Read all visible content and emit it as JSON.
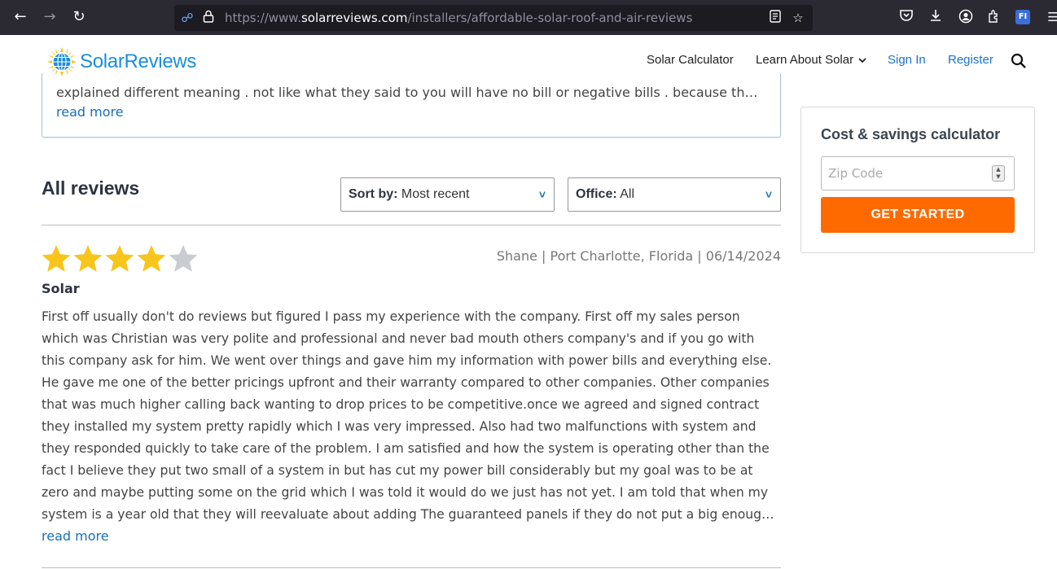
{
  "browser": {
    "url_prefix": "https://www.",
    "url_host": "solarreviews.com",
    "url_path": "/installers/affordable-solar-roof-and-air-reviews",
    "extension_badge": "FI"
  },
  "header": {
    "logo_text": "SolarReviews",
    "menu": {
      "calculator": "Solar Calculator",
      "learn": "Learn About Solar",
      "sign_in": "Sign In",
      "register": "Register"
    }
  },
  "previous_review": {
    "text_tail": "explained different meaning . not like what they said to you will have no bill or negative bills . because they never tell you about the true-up",
    "read_more": "read more"
  },
  "calculator": {
    "title": "Cost & savings calculator",
    "zip_placeholder": "Zip Code",
    "cta": "GET STARTED"
  },
  "reviews_section": {
    "title": "All reviews",
    "sort_label": "Sort by:",
    "sort_value": "Most recent",
    "office_label": "Office:",
    "office_value": "All"
  },
  "review": {
    "rating": 4,
    "max_rating": 5,
    "author": "Shane",
    "location": "Port Charlotte, Florida",
    "date": "06/14/2024",
    "title": "Solar",
    "body": "First off usually don't do reviews but figured I pass my experience with the company. First off my sales person which was Christian was very polite and professional and never bad mouth others company's and if you go with this company ask for him. We went over things and gave him my information with power bills and everything else. He gave me one of the better pricings upfront and their warranty compared to other companies. Other companies that was much higher calling back wanting to drop prices to be competitive.once we agreed and signed contract they installed my system pretty rapidly which I was very impressed. Also had two malfunctions with system and they responded quickly to take care of the problem. I am satisfied and how the system is operating other than the fact I believe they put two small of a system in but has cut my power bill considerably but my goal was to be at zero and maybe putting some on the grid which I was told it would do we just has not yet. I am told that when my system is a year old that they will reevaluate about adding The guaranteed panels if they do not put a big enough system in. I guess we will see in February how that goes. Other than that I am happy with the company.",
    "read_more": "read more"
  },
  "colors": {
    "brand_blue": "#1a8fd8",
    "cta_orange": "#ff6a00",
    "star_filled": "#f8c51c",
    "star_empty": "#c9ccd1",
    "link_blue": "#1a6fb8"
  }
}
